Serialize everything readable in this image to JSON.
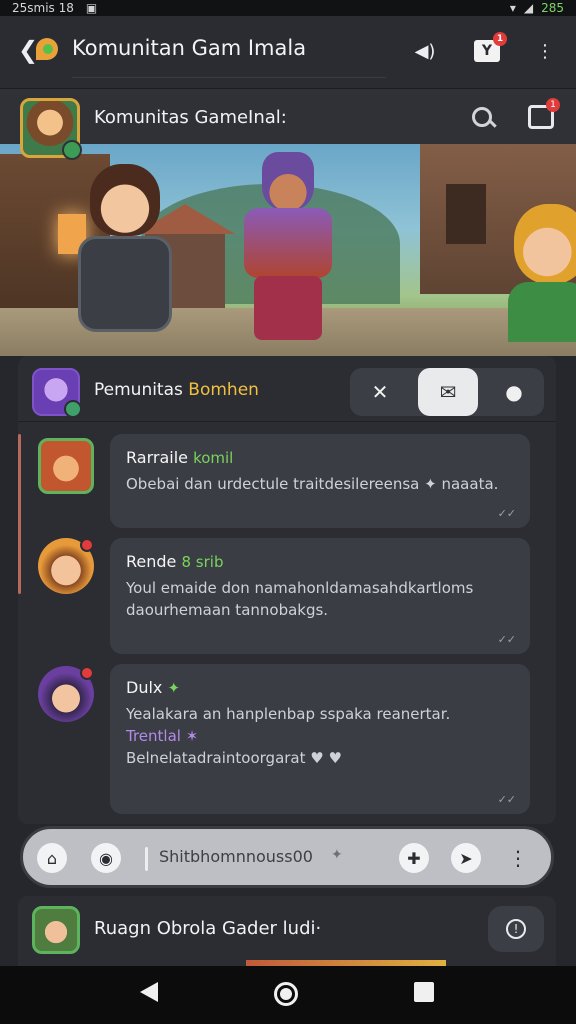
{
  "status_bar": {
    "time": "25smis 18",
    "battery": "285"
  },
  "app_bar": {
    "title": "Komunitan Gam Imala",
    "mail_badge": "1",
    "mail_glyph": "Y"
  },
  "community": {
    "name": "Komunitas GameInal:",
    "compose_badge": "1"
  },
  "panel": {
    "title": "Pemunitas",
    "title_accent": "Bomhen"
  },
  "messages": [
    {
      "author": "Rarraile",
      "tag": "komil",
      "text": "Obebai dan urdectule traitdesilereensa ✦ naaata."
    },
    {
      "author": "Rende",
      "tag": "8 srib",
      "text": "Youl emaide don namahonldamasahdkartloms daourhemaan tannobakgs."
    },
    {
      "author": "Dulx",
      "tag": "✦",
      "text": "Yealakara an hanplenbap sspaka reanertar.",
      "text_accent": "Trentlal ✶",
      "text_after": "Belnelatadraintoorgarat ♥ ♥"
    }
  ],
  "input": {
    "placeholder": "Shitbhomnnouss00"
  },
  "room": {
    "title": "Ruagn Obrola Gader ludi·"
  },
  "colors": {
    "background": "#25272c",
    "panel": "#2b2d32",
    "bubble": "#3a3d43",
    "accent_green": "#7ad35c",
    "accent_purple": "#b28be8",
    "badge_red": "#e23b3b"
  },
  "icons": {
    "back": "arrow-left-icon",
    "app_logo": "game-logo-icon",
    "more": "more-vertical-icon",
    "search": "search-icon",
    "compose": "compose-icon",
    "mute": "mute-icon",
    "mail": "mail-icon",
    "chat": "chat-bubble-icon",
    "home": "home-icon",
    "camera": "camera-icon",
    "send": "send-icon",
    "sticker": "sticker-icon",
    "info": "info-icon"
  }
}
